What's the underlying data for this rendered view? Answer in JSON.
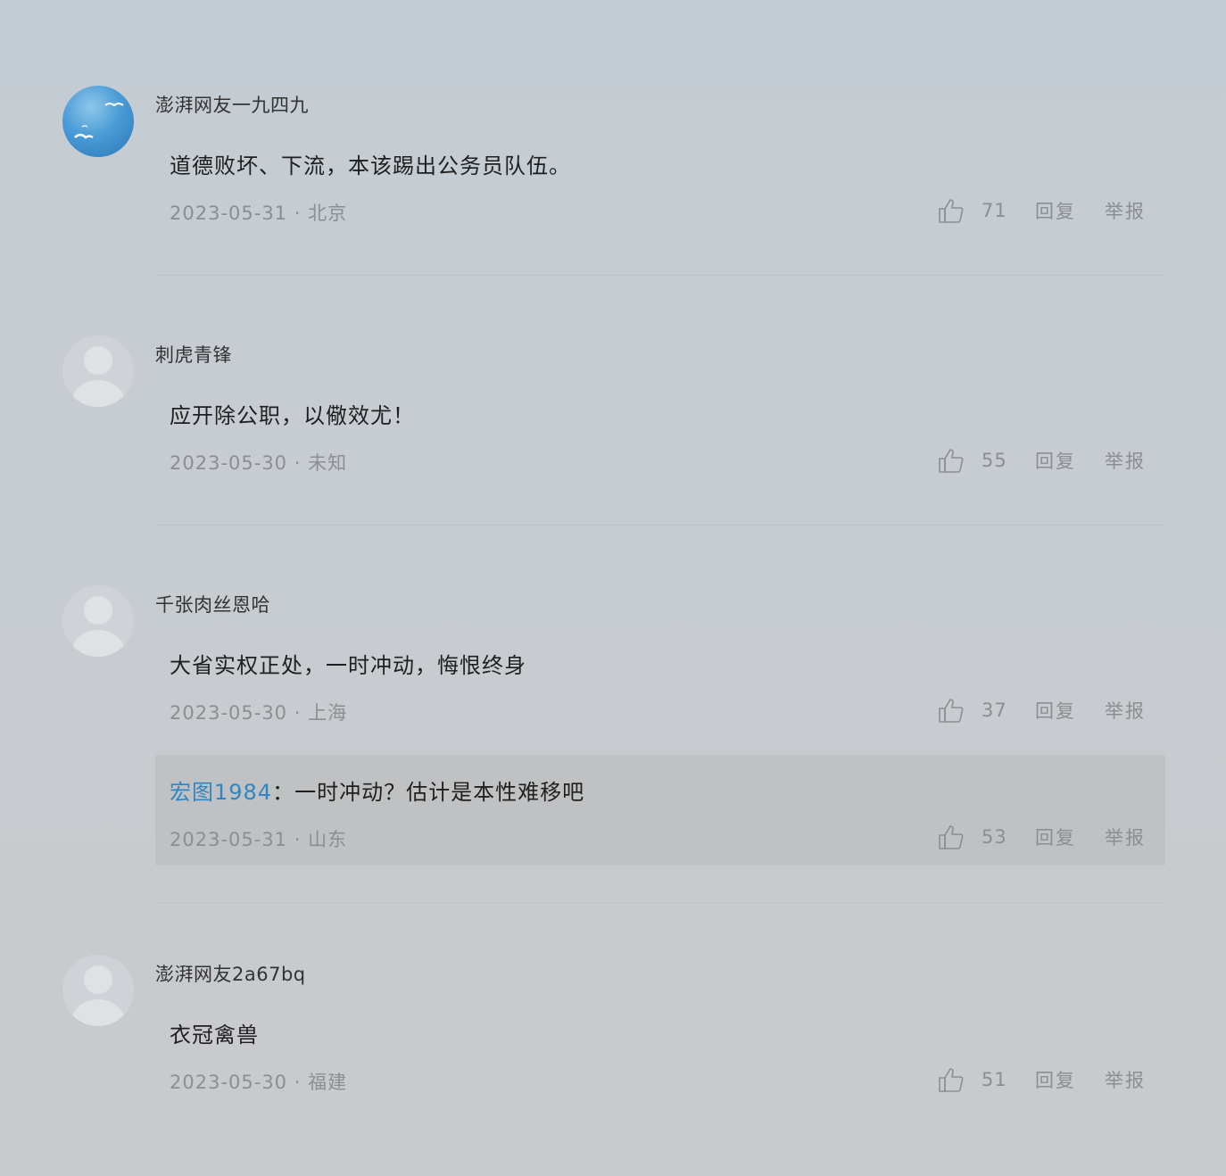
{
  "comments": [
    {
      "username": "澎湃网友一九四九",
      "text": "道德败坏、下流，本该踢出公务员队伍。",
      "meta": "2023-05-31 · 北京",
      "likes": "71",
      "reply_label": "回复",
      "report_label": "举报"
    },
    {
      "username": "刺虎青锋",
      "text": "应开除公职，以儆效尤！",
      "meta": "2023-05-30 · 未知",
      "likes": "55",
      "reply_label": "回复",
      "report_label": "举报"
    },
    {
      "username": "千张肉丝恩哈",
      "text": "大省实权正处，一时冲动，悔恨终身",
      "meta": "2023-05-30 · 上海",
      "likes": "37",
      "reply_label": "回复",
      "report_label": "举报",
      "reply": {
        "author": "宏图1984",
        "separator": "：",
        "text": "一时冲动？估计是本性难移吧",
        "meta": "2023-05-31 · 山东",
        "likes": "53",
        "reply_label": "回复",
        "report_label": "举报"
      }
    },
    {
      "username": "澎湃网友2a67bq",
      "text": "衣冠禽兽",
      "meta": "2023-05-30 · 福建",
      "likes": "51",
      "reply_label": "回复",
      "report_label": "举报"
    }
  ],
  "colors": {
    "link": "#2f86c4",
    "meta": "#8c8e91",
    "text": "#1f1f1f"
  },
  "icons": {
    "like": "thumbs-up-icon",
    "default_avatar": "user-silhouette",
    "custom_avatar": "sky-with-seagulls"
  }
}
